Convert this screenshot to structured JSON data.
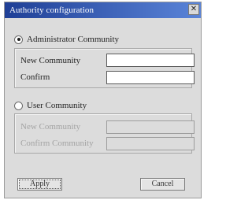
{
  "window": {
    "title": "Authority configuration",
    "close_glyph": "✕"
  },
  "admin_community": {
    "label": "Administrator Community",
    "selected": true,
    "new_community_label": "New Community",
    "new_community_value": "",
    "confirm_label": "Confirm",
    "confirm_value": ""
  },
  "user_community": {
    "label": "User Community",
    "selected": false,
    "new_community_label": "New Community",
    "new_community_value": "",
    "confirm_label": "Confirm Community",
    "confirm_value": ""
  },
  "buttons": {
    "apply_label": "Apply",
    "cancel_label": "Cancel"
  },
  "icons": {
    "close": "close-icon"
  }
}
